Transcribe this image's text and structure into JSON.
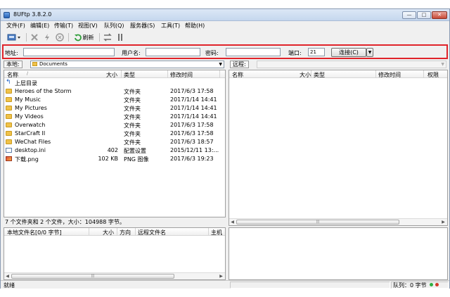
{
  "window": {
    "title": "8UFtp 3.8.2.0",
    "min": "—",
    "max": "□",
    "close": "✕"
  },
  "menu": [
    "文件(F)",
    "编辑(E)",
    "传输(T)",
    "视图(V)",
    "队列(Q)",
    "服务器(S)",
    "工具(T)",
    "帮助(H)"
  ],
  "toolbar": {
    "refresh_label": "刷新",
    "icons": [
      "site-manager-icon",
      "disconnect-icon",
      "quick-connect-icon",
      "stop-icon",
      "refresh-icon",
      "transfer-icon",
      "pause-icon"
    ]
  },
  "connect": {
    "address_label": "地址:",
    "address_value": "",
    "user_label": "用户名:",
    "user_value": "",
    "password_label": "密码:",
    "password_value": "",
    "port_label": "端口:",
    "port_value": "21",
    "connect_button": "连接(C)"
  },
  "local": {
    "label": "本地:",
    "path": "Documents",
    "columns": [
      "名称",
      "大小",
      "类型",
      "修改时间"
    ],
    "rows": [
      {
        "name": "上层目录",
        "size": "",
        "type": "",
        "modified": "",
        "icon": "up-icon"
      },
      {
        "name": "Heroes of the Storm",
        "size": "",
        "type": "文件夹",
        "modified": "2017/6/3 17:58",
        "icon": "folder-icon"
      },
      {
        "name": "My Music",
        "size": "",
        "type": "文件夹",
        "modified": "2017/1/14 14:41",
        "icon": "folder-icon"
      },
      {
        "name": "My Pictures",
        "size": "",
        "type": "文件夹",
        "modified": "2017/1/14 14:41",
        "icon": "folder-icon"
      },
      {
        "name": "My Videos",
        "size": "",
        "type": "文件夹",
        "modified": "2017/1/14 14:41",
        "icon": "folder-icon"
      },
      {
        "name": "Overwatch",
        "size": "",
        "type": "文件夹",
        "modified": "2017/6/3 17:58",
        "icon": "folder-icon"
      },
      {
        "name": "StarCraft II",
        "size": "",
        "type": "文件夹",
        "modified": "2017/6/3 17:58",
        "icon": "folder-icon"
      },
      {
        "name": "WeChat Files",
        "size": "",
        "type": "文件夹",
        "modified": "2017/6/3 18:57",
        "icon": "folder-icon"
      },
      {
        "name": "desktop.ini",
        "size": "402",
        "type": "配置设置",
        "modified": "2015/12/11 13:...",
        "icon": "ini-icon"
      },
      {
        "name": "下载.png",
        "size": "102 KB",
        "type": "PNG 图像",
        "modified": "2017/6/3 19:23",
        "icon": "png-icon"
      }
    ],
    "status": "7 个文件夹和 2 个文件，大小：104988 字节。"
  },
  "remote": {
    "label": "远程:",
    "columns": [
      "名称",
      "大小",
      "类型",
      "修改时间",
      "权限"
    ]
  },
  "queue": {
    "columns": [
      "本地文件名[0/0 字节]",
      "大小",
      "方向",
      "远程文件名",
      "主机"
    ]
  },
  "statusbar": {
    "left": "就绪",
    "queue": "队列：0 字节"
  },
  "colors": {
    "highlight_border": "#e0242a",
    "folder": "#f0c24a"
  }
}
